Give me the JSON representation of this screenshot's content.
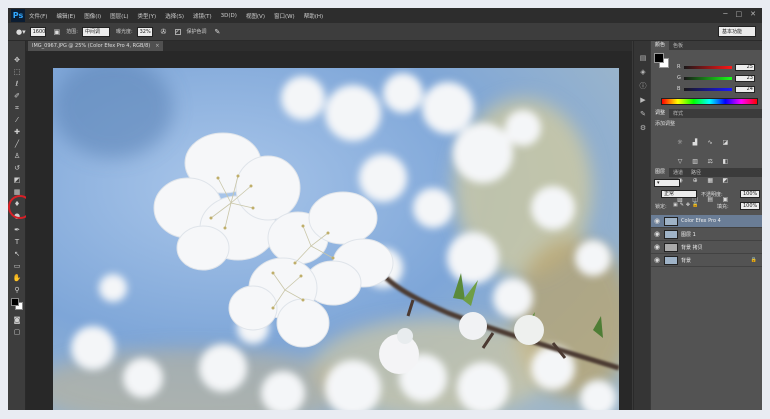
{
  "app": {
    "logo": "Ps"
  },
  "menu": [
    "文件(F)",
    "编辑(E)",
    "图像(I)",
    "图层(L)",
    "类型(Y)",
    "选择(S)",
    "滤镜(T)",
    "3D(D)",
    "视图(V)",
    "窗口(W)",
    "帮助(H)"
  ],
  "options": {
    "size_value": "1600",
    "range_label": "范围:",
    "range_value": "中间调",
    "exposure_label": "曝光度:",
    "exposure_value": "32%",
    "protect_tones_label": "保护色调",
    "workspace_value": "基本功能"
  },
  "document": {
    "tab_title": "IMG_0967.JPG @ 25% (Color Efex Pro 4, RGB/8)",
    "close": "×"
  },
  "panels": {
    "color_tabs": [
      "颜色",
      "色板"
    ],
    "color": {
      "r": "25",
      "g": "23",
      "b": "24"
    },
    "adjust_tabs": [
      "调整",
      "样式"
    ],
    "adjust_title": "添加调整",
    "layer_tabs": [
      "图层",
      "通道",
      "路径"
    ],
    "blend_mode": "正常",
    "opacity_label": "不透明度:",
    "opacity_value": "100%",
    "lock_label": "锁定:",
    "fill_label": "填充:",
    "fill_value": "100%",
    "layers": [
      {
        "name": "Color Efex Pro 4",
        "selected": true
      },
      {
        "name": "图层 1",
        "selected": false
      },
      {
        "name": "背景 拷贝",
        "selected": false
      },
      {
        "name": "背景",
        "selected": false,
        "locked": true
      }
    ]
  },
  "tool_icons": [
    "move-tool-icon",
    "marquee-tool-icon",
    "lasso-tool-icon",
    "quick-select-tool-icon",
    "crop-tool-icon",
    "eyedropper-tool-icon",
    "healing-brush-tool-icon",
    "brush-tool-icon",
    "clone-stamp-tool-icon",
    "history-brush-tool-icon",
    "eraser-tool-icon",
    "gradient-tool-icon",
    "blur-tool-icon",
    "dodge-tool-icon",
    "pen-tool-icon",
    "type-tool-icon",
    "path-select-tool-icon",
    "shape-tool-icon",
    "hand-tool-icon",
    "zoom-tool-icon"
  ],
  "colors": {
    "accent_red": "#d81f26",
    "selected_layer": "#6a7d96",
    "sky": "#7ea6d8"
  }
}
